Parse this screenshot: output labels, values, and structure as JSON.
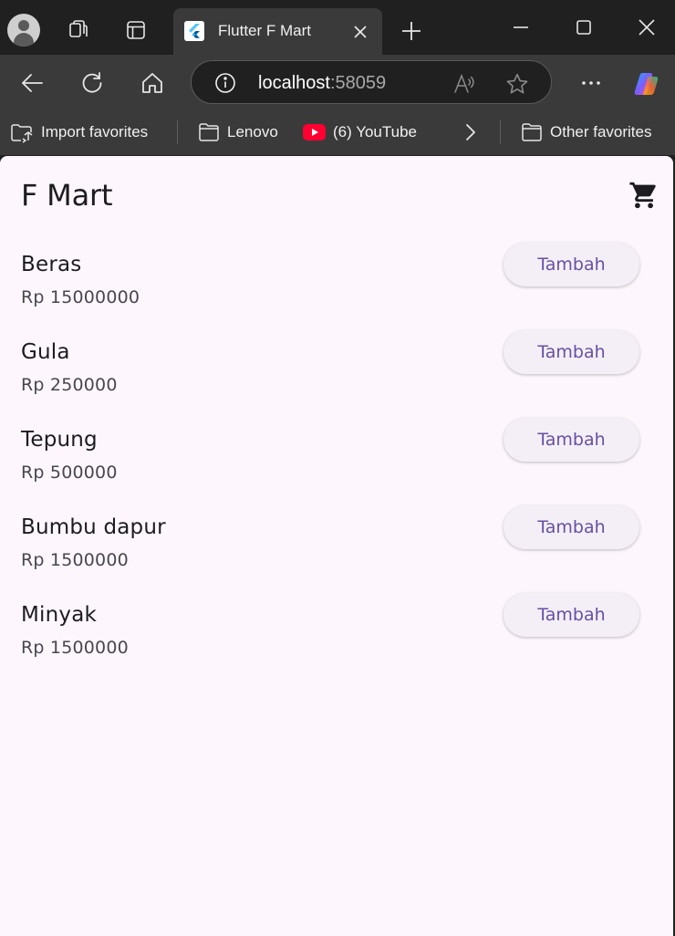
{
  "browser": {
    "tab": {
      "title": "Flutter F Mart"
    },
    "address": {
      "host": "localhost",
      "port": ":58059"
    },
    "favorites": [
      {
        "label": "Import favorites"
      },
      {
        "label": "Lenovo"
      },
      {
        "label": "(6) YouTube"
      },
      {
        "label": "Other favorites"
      }
    ],
    "colors": {
      "chrome_dark": "#202020",
      "chrome": "#3a3a3a"
    }
  },
  "app": {
    "title": "F Mart",
    "cart_icon": "shopping-cart-icon",
    "products": [
      {
        "name": "Beras",
        "price": "Rp 15000000",
        "button": "Tambah"
      },
      {
        "name": "Gula",
        "price": "Rp 250000",
        "button": "Tambah"
      },
      {
        "name": "Tepung",
        "price": "Rp 500000",
        "button": "Tambah"
      },
      {
        "name": "Bumbu dapur",
        "price": "Rp 1500000",
        "button": "Tambah"
      },
      {
        "name": "Minyak",
        "price": "Rp 1500000",
        "button": "Tambah"
      }
    ],
    "colors": {
      "background": "#fdf7fd",
      "button_bg": "#f4eff7",
      "accent": "#6750a4"
    }
  }
}
